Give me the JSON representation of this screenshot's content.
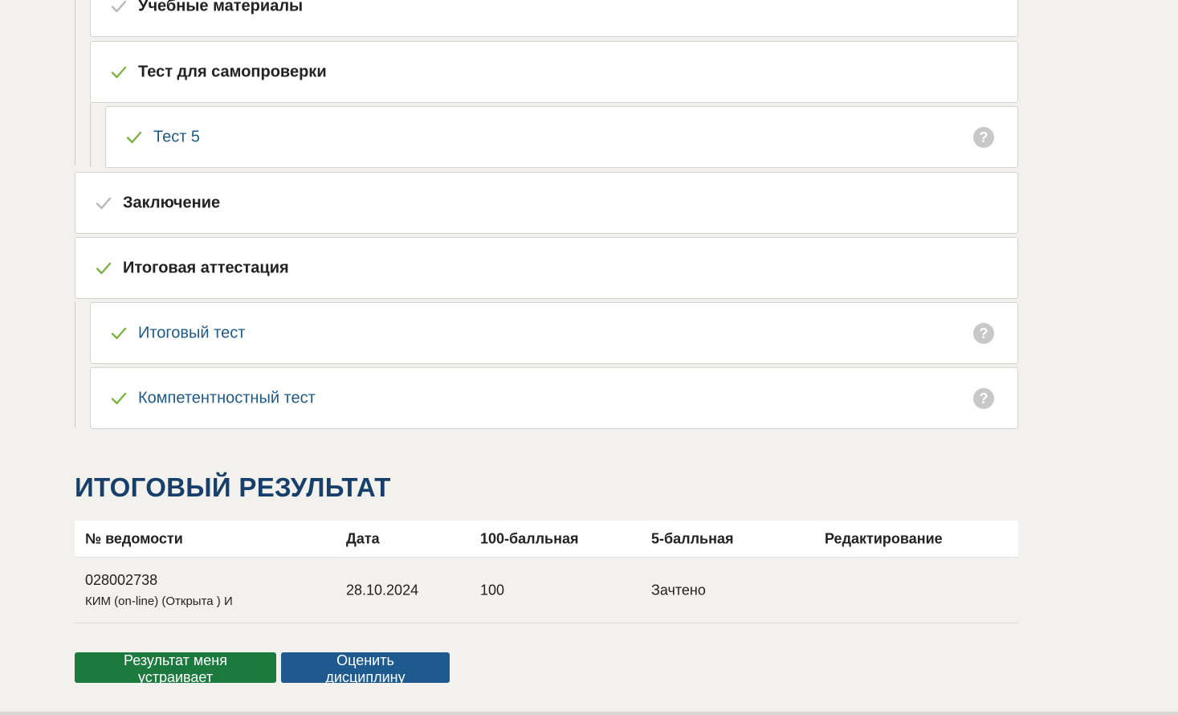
{
  "colors": {
    "accent_green": "#1d7a3f",
    "accent_blue": "#1f5a8f",
    "check_done": "#7cb342",
    "check_pending": "#b8b8b8",
    "heading": "#173f69"
  },
  "course_items": [
    {
      "label": "Учебные материалы",
      "kind": "section",
      "status": "pending",
      "icon": "check-icon"
    },
    {
      "label": "Тест для самопроверки",
      "kind": "section",
      "status": "done",
      "icon": "check-icon"
    },
    {
      "label": "Тест 5",
      "kind": "activity",
      "status": "done",
      "icon": "check-icon",
      "help_icon": "question-icon",
      "help_glyph": "?"
    },
    {
      "label": "Заключение",
      "kind": "section",
      "status": "pending",
      "icon": "check-icon"
    },
    {
      "label": "Итоговая аттестация",
      "kind": "section",
      "status": "done",
      "icon": "check-icon"
    },
    {
      "label": "Итоговый тест",
      "kind": "activity",
      "status": "done",
      "icon": "check-icon",
      "help_icon": "question-icon",
      "help_glyph": "?"
    },
    {
      "label": "Компетентностный тест",
      "kind": "activity",
      "status": "done",
      "icon": "check-icon",
      "help_icon": "question-icon",
      "help_glyph": "?"
    }
  ],
  "result": {
    "heading": "ИТОГОВЫЙ РЕЗУЛЬТАТ",
    "columns": [
      "№ ведомости",
      "Дата",
      "100-балльная",
      "5-балльная",
      "Редактирование"
    ],
    "rows": [
      {
        "sheet_number": "028002738",
        "sheet_type": "КИМ (on-line) (Открыта ) И",
        "date": "28.10.2024",
        "score_100": "100",
        "score_5": "Зачтено",
        "edit": ""
      }
    ]
  },
  "actions": {
    "accept_label": "Результат меня устраивает",
    "rate_label": "Оценить дисциплину"
  }
}
